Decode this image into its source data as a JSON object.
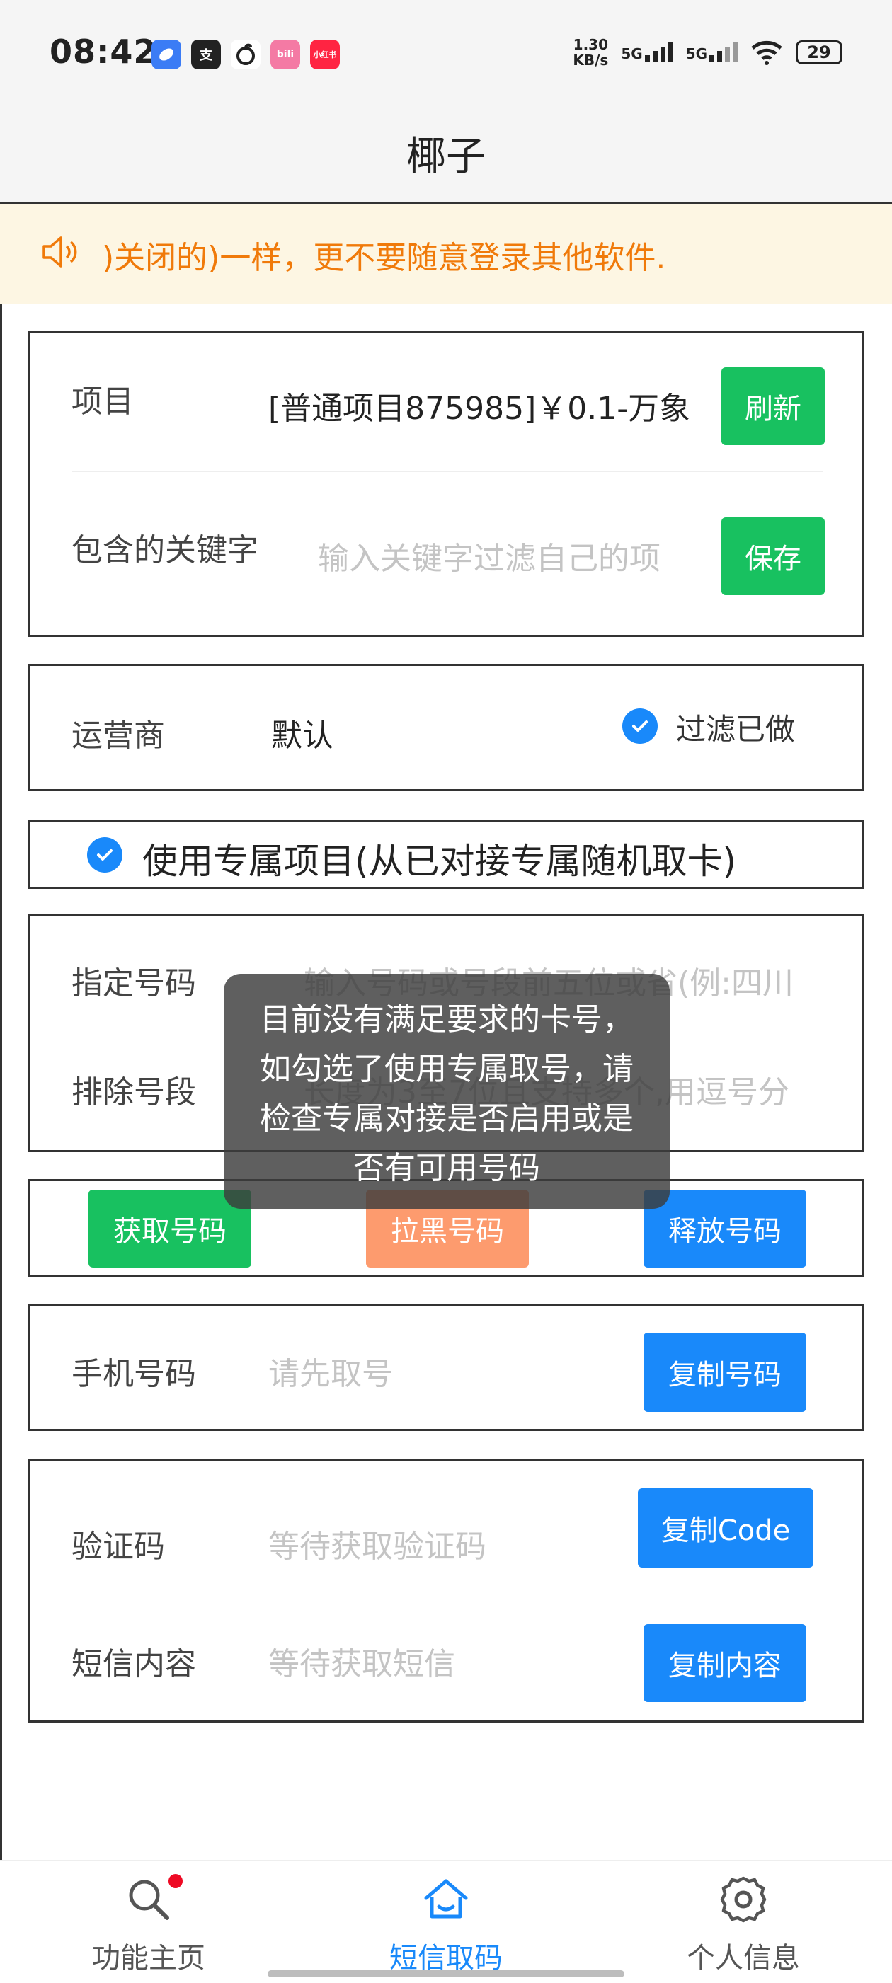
{
  "status_bar": {
    "time": "08:42",
    "net_speed_value": "1.30",
    "net_speed_unit": "KB/s",
    "signal_1": "5G",
    "signal_2": "5G",
    "battery": "29",
    "app_icons": [
      {
        "name": "browser-app-icon",
        "color": "#3b7cf5",
        "glyph": ""
      },
      {
        "name": "alipay-app-icon",
        "color": "#222222",
        "glyph": "支"
      },
      {
        "name": "netease-music-app-icon",
        "color": "#222222",
        "glyph": "♫"
      },
      {
        "name": "bilibili-app-icon",
        "color": "#f47aa4",
        "glyph": "bili"
      },
      {
        "name": "xiaohongshu-app-icon",
        "color": "#ff2442",
        "glyph": "小红书"
      }
    ]
  },
  "nav": {
    "title": "椰子"
  },
  "notice": {
    "text": ")关闭的)一样，更不要随意登录其他软件.",
    "icon": "speaker-icon",
    "color": "#f07a0a"
  },
  "project_card": {
    "project_label": "项目",
    "project_value": "[普通项目875985]￥0.1-万象",
    "refresh_button": "刷新",
    "keyword_label": "包含的关键字",
    "keyword_placeholder": "输入关键字过滤自己的项",
    "save_button": "保存"
  },
  "carrier_card": {
    "label": "运营商",
    "value": "默认",
    "filter_label": "过滤已做",
    "filter_checked": true
  },
  "exclusive": {
    "label": "使用专属项目(从已对接专属随机取卡)",
    "checked": true
  },
  "number_filter": {
    "specify_label": "指定号码",
    "specify_placeholder": "输入号码或号段前五位或省(例:四川",
    "exclude_label": "排除号段",
    "exclude_placeholder": "长度为3至7位且支持多个,用逗号分"
  },
  "actions": {
    "get_number": "获取号码",
    "blacklist_number": "拉黑号码",
    "release_number": "释放号码"
  },
  "phone_card": {
    "label": "手机号码",
    "placeholder": "请先取号",
    "copy_button": "复制号码"
  },
  "code_card": {
    "code_label": "验证码",
    "code_placeholder": "等待获取验证码",
    "copy_code_button": "复制Code",
    "sms_label": "短信内容",
    "sms_placeholder": "等待获取短信",
    "copy_sms_button": "复制内容"
  },
  "toast": {
    "message": "目前没有满足要求的卡号，如勾选了使用专属取号，请检查专属对接是否启用或是否有可用号码"
  },
  "tabbar": {
    "tabs": [
      {
        "label": "功能主页",
        "icon": "search-icon",
        "active": false,
        "badge": true
      },
      {
        "label": "短信取码",
        "icon": "home-icon",
        "active": true,
        "badge": false
      },
      {
        "label": "个人信息",
        "icon": "gear-icon",
        "active": false,
        "badge": false
      }
    ]
  },
  "colors": {
    "green": "#18c160",
    "blue": "#1989fa",
    "orange": "#fd9b6e",
    "notice_bg": "#fdf6e3"
  }
}
